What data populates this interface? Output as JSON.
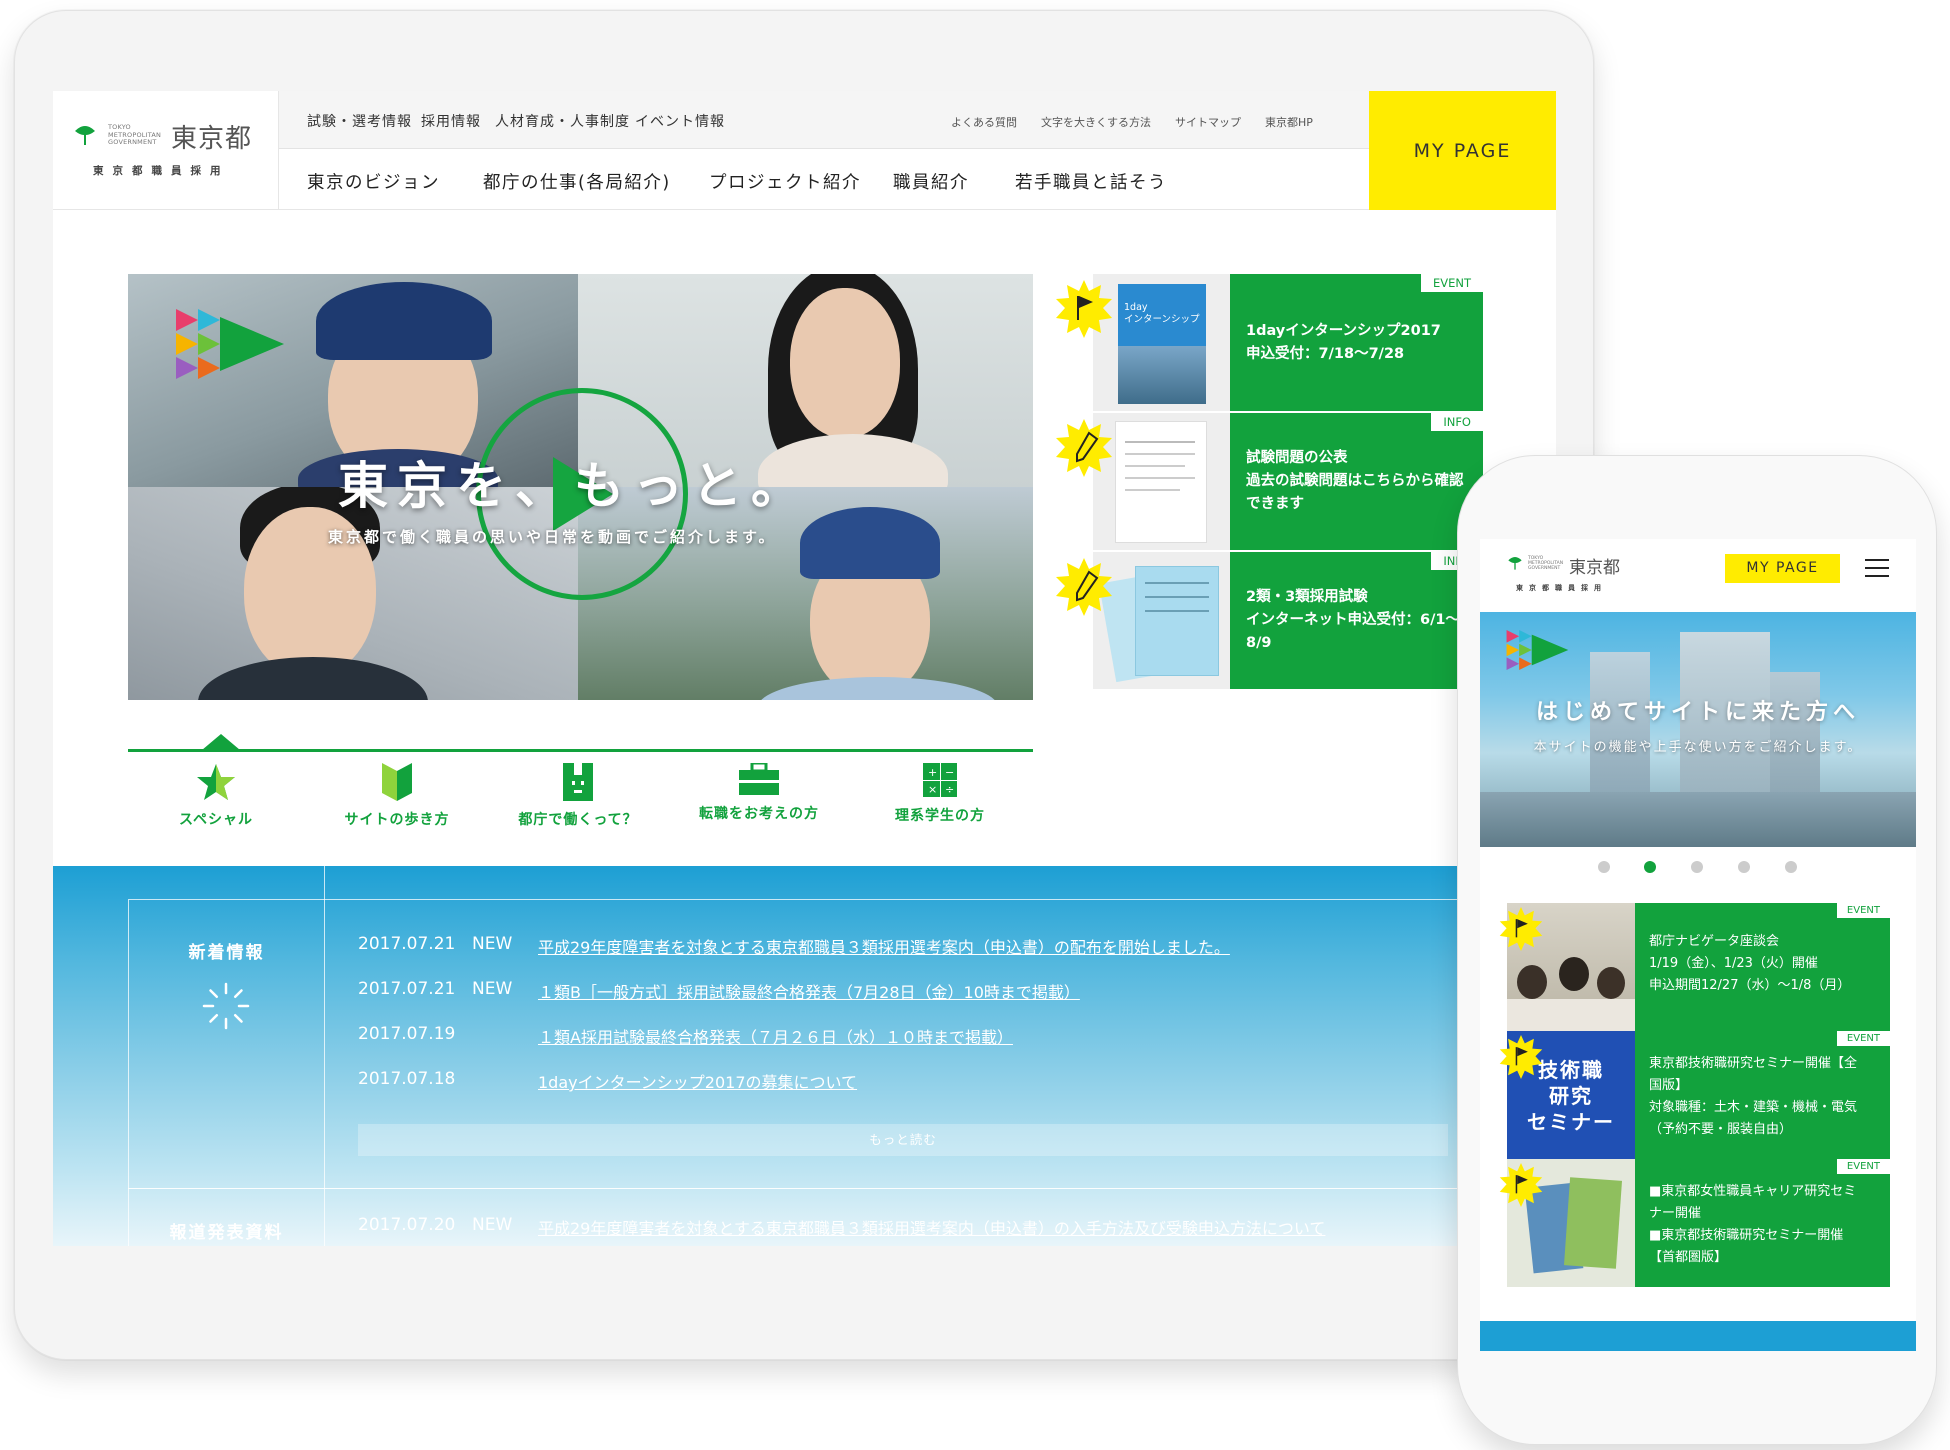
{
  "desktop": {
    "logo": {
      "small_en": "TOKYO\nMETROPOLITAN\nGOVERNMENT",
      "main": "東京都",
      "sub": "東京都職員採用"
    },
    "top_nav": [
      "試験・選考情報",
      "採用情報",
      "人材育成・人事制度",
      "イベント情報"
    ],
    "utility_links": [
      "よくある質問",
      "文字を大きくする方法",
      "サイトマップ",
      "東京都HP"
    ],
    "main_nav": [
      "東京のビジョン",
      "都庁の仕事(各局紹介)",
      "プロジェクト紹介",
      "職員紹介",
      "若手職員と話そう"
    ],
    "mypage_label": "MY PAGE",
    "hero": {
      "title": "東京を、もっと。",
      "subtitle": "東京都で働く職員の思いや日常を動画でご紹介します。"
    },
    "icon_links": [
      {
        "label": "スペシャル",
        "icon": "star-icon"
      },
      {
        "label": "サイトの歩き方",
        "icon": "beginner-mark-icon"
      },
      {
        "label": "都庁で働くって？",
        "icon": "building-icon"
      },
      {
        "label": "転職をお考えの方",
        "icon": "briefcase-icon"
      },
      {
        "label": "理系学生の方",
        "icon": "calculator-icon"
      }
    ],
    "event_cards": [
      {
        "badge": "EVENT",
        "line1": "1dayインターンシップ2017",
        "line2": "申込受付：7/18〜7/28",
        "line3": "",
        "thumb_text": "1day\nインターンシップ"
      },
      {
        "badge": "INFO",
        "line1": "試験問題の公表",
        "line2": "過去の試験問題はこちらから確認",
        "line3": "できます"
      },
      {
        "badge": "INFO",
        "line1": "2類・3類採用試験",
        "line2": "インターネット申込受付：6/1〜",
        "line3": "8/9"
      }
    ],
    "news": {
      "heading": "新着情報",
      "items": [
        {
          "date": "2017.07.21",
          "new": "NEW",
          "title": "平成29年度障害者を対象とする東京都職員３類採用選考案内（申込書）の配布を開始しました。"
        },
        {
          "date": "2017.07.21",
          "new": "NEW",
          "title": "１類B［一般方式］採用試験最終合格発表（7月28日（金）10時まで掲載）"
        },
        {
          "date": "2017.07.19",
          "new": "",
          "title": "１類A採用試験最終合格発表（７月２６日（水）１０時まで掲載）"
        },
        {
          "date": "2017.07.18",
          "new": "",
          "title": "1dayインターンシップ2017の募集について"
        }
      ],
      "more_label": "もっと読む",
      "press_heading": "報道発表資料",
      "press_items": [
        {
          "date": "2017.07.20",
          "new": "NEW",
          "title": "平成29年度障害者を対象とする東京都職員３類採用選考案内（申込書）の入手方法及び受験申込方法について"
        }
      ]
    }
  },
  "mobile": {
    "logo": {
      "small_en": "TOKYO\nMETROPOLITAN\nGOVERNMENT",
      "main": "東京都",
      "sub": "東京都職員採用"
    },
    "mypage_label": "MY PAGE",
    "menu_icon": "hamburger-menu-icon",
    "hero": {
      "title": "はじめてサイトに来た方へ",
      "subtitle": "本サイトの機能や上手な使い方をご紹介します。"
    },
    "carousel": {
      "count": 5,
      "active": 2
    },
    "cards": [
      {
        "badge": "EVENT",
        "lines": [
          "都庁ナビゲータ座談会",
          "1/19（金）、1/23（火）開催",
          "申込期間12/27（水）〜1/8（月）"
        ]
      },
      {
        "badge": "EVENT",
        "thumb_text": "技術職\n研究\nセミナー",
        "lines": [
          "東京都技術職研究セミナー開催【全",
          "国版】",
          "対象職種：土木・建築・機械・電気",
          "（予約不要・服装自由）"
        ]
      },
      {
        "badge": "EVENT",
        "lines": [
          "■東京都女性職員キャリア研究セミ",
          "ナー開催",
          "■東京都技術職研究セミナー開催",
          "【首都圏版】"
        ]
      }
    ]
  },
  "colors": {
    "brand_green": "#12a23d",
    "accent_yellow": "#ffec00",
    "news_blue": "#1d9fd4"
  }
}
